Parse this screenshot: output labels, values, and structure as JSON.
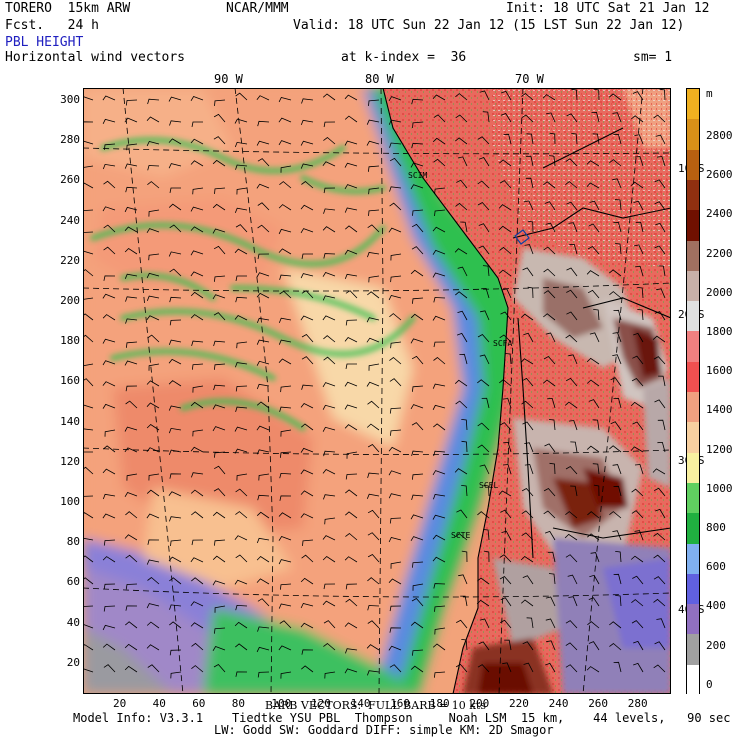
{
  "header": {
    "model": "TORERO  15km ARW",
    "org": "NCAR/MMM",
    "init": "Init: 18 UTC Sat 21 Jan 12",
    "fcst": "Fcst.   24 h",
    "valid": "Valid: 18 UTC Sun 22 Jan 12 (15 LST Sun 22 Jan 12)",
    "field": "PBL HEIGHT",
    "field2": "Horizontal wind vectors",
    "kindex": "at k-index =  36",
    "sm": "sm= 1"
  },
  "lon_labels": [
    "90 W",
    "80 W",
    "70 W"
  ],
  "lat_labels": [
    "10 S",
    "20 S",
    "30 S",
    "40 S"
  ],
  "x_ticks": [
    "20",
    "40",
    "60",
    "80",
    "100",
    "120",
    "140",
    "160",
    "180",
    "200",
    "220",
    "240",
    "260",
    "280"
  ],
  "y_ticks": [
    "300",
    "280",
    "260",
    "240",
    "220",
    "200",
    "180",
    "160",
    "140",
    "120",
    "100",
    "80",
    "60",
    "40",
    "20"
  ],
  "colorbar": {
    "unit": "m",
    "labels": [
      "2800",
      "2600",
      "2400",
      "2200",
      "2000",
      "1800",
      "1600",
      "1400",
      "1200",
      "1000",
      "800",
      "600",
      "400",
      "200",
      "0"
    ],
    "colors": [
      "#f0b020",
      "#d89018",
      "#b86010",
      "#903010",
      "#701000",
      "#a07060",
      "#c8b0a8",
      "#e0e0e0",
      "#f08080",
      "#f05050",
      "#f0a080",
      "#f8d0a0",
      "#f8f0a0",
      "#60d060",
      "#20b040",
      "#80b0f0",
      "#6060e0",
      "#9070c0",
      "#a0a0a0",
      "#ffffff"
    ]
  },
  "footer": {
    "barb": "BARB VECTORS:  FULL BARB = 10 kts",
    "line1": "Model Info: V3.3.1    Tiedtke YSU PBL  Thompson     Noah LSM  15 km,    44 levels,   90 sec",
    "line2": "LW: Godd SW: Goddard DIFF: simple KM: 2D Smagor"
  },
  "map_labels": [
    "SCIM",
    "SCFA",
    "SCEL",
    "SCTE"
  ]
}
